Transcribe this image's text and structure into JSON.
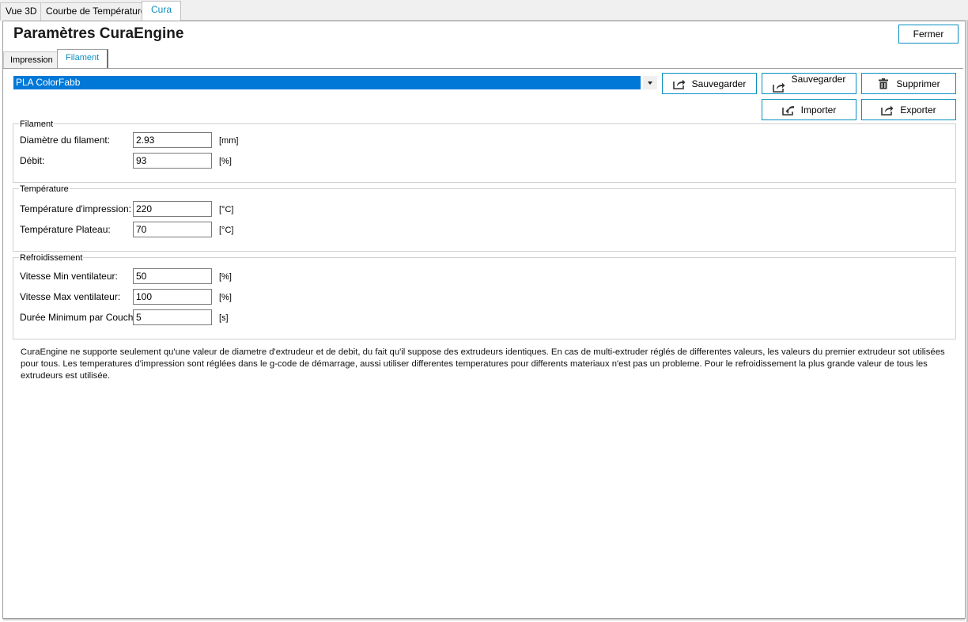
{
  "top_tabs": [
    {
      "label": "Vue 3D",
      "active": false
    },
    {
      "label": "Courbe de Température",
      "active": false
    },
    {
      "label": "Cura",
      "active": true
    }
  ],
  "header": {
    "title": "Paramètres CuraEngine",
    "close_label": "Fermer"
  },
  "sub_tabs": [
    {
      "label": "Impression",
      "active": false
    },
    {
      "label": "Filament",
      "active": true
    }
  ],
  "profile": {
    "selected": "PLA ColorFabb"
  },
  "actions": {
    "save1": "Sauvegarder",
    "save2": "Sauvegarder",
    "delete": "Supprimer",
    "import": "Importer",
    "export": "Exporter"
  },
  "groups": {
    "filament": {
      "title": "Filament",
      "rows": [
        {
          "label": "Diamètre du filament:",
          "value": "2.93",
          "unit": "[mm]"
        },
        {
          "label": "Débit:",
          "value": "93",
          "unit": "[%]"
        }
      ]
    },
    "temperature": {
      "title": "Température",
      "rows": [
        {
          "label": "Température d'impression:",
          "value": "220",
          "unit": "[°C]"
        },
        {
          "label": "Température Plateau:",
          "value": "70",
          "unit": "[°C]"
        }
      ]
    },
    "cooling": {
      "title": "Refroidissement",
      "rows": [
        {
          "label": "Vitesse Min ventilateur:",
          "value": "50",
          "unit": "[%]"
        },
        {
          "label": "Vitesse Max ventilateur:",
          "value": "100",
          "unit": "[%]"
        },
        {
          "label": "Durée Minimum par Couche:",
          "value": "5",
          "unit": "[s]"
        }
      ]
    }
  },
  "note": "CuraEngine ne supporte seulement qu'une valeur de diametre d'extrudeur et de debit, du fait qu'il suppose des extrudeurs identiques. En cas de multi-extruder réglés de differentes valeurs, les valeurs du premier extrudeur sot utilisées pour tous. Les temperatures d'impression sont réglées dans le g-code de démarrage, aussi utiliser differentes temperatures pour differents materiaux n'est pas un probleme. Pour le refroidissement la plus grande valeur de tous les extrudeurs est utilisée.",
  "colors": {
    "accent": "#0a8fc0",
    "selection": "#0078d7"
  },
  "icons": {
    "save": "share-arrow-icon",
    "delete": "trash-icon",
    "import": "import-arrow-icon",
    "export": "share-arrow-icon"
  }
}
